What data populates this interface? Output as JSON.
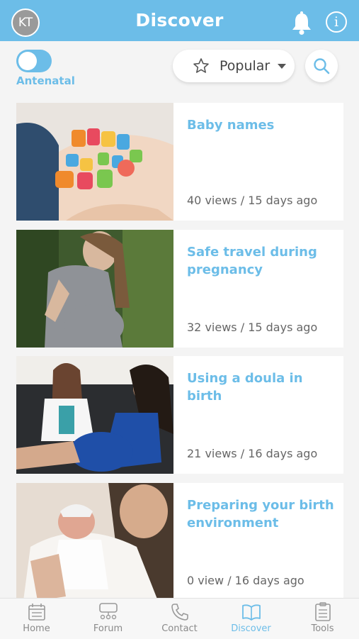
{
  "header": {
    "avatar_initials": "KT",
    "title": "Discover"
  },
  "filters": {
    "toggle_label": "Antenatal",
    "toggle_on": true,
    "sort_label": "Popular"
  },
  "articles": [
    {
      "title": "Baby names",
      "meta": "40 views / 15 days ago"
    },
    {
      "title": "Safe travel during pregnancy",
      "meta": "32 views / 15 days ago"
    },
    {
      "title": "Using a doula in birth",
      "meta": "21 views / 16 days ago"
    },
    {
      "title": "Preparing your birth environment",
      "meta": "0 view / 16 days ago"
    }
  ],
  "nav": {
    "items": [
      {
        "label": "Home",
        "icon": "home-icon"
      },
      {
        "label": "Forum",
        "icon": "forum-icon"
      },
      {
        "label": "Contact",
        "icon": "phone-icon"
      },
      {
        "label": "Discover",
        "icon": "book-icon"
      },
      {
        "label": "Tools",
        "icon": "tools-icon"
      }
    ],
    "active": "Discover"
  },
  "colors": {
    "accent": "#6cbde8",
    "background": "#f4f4f4",
    "card": "#ffffff"
  }
}
